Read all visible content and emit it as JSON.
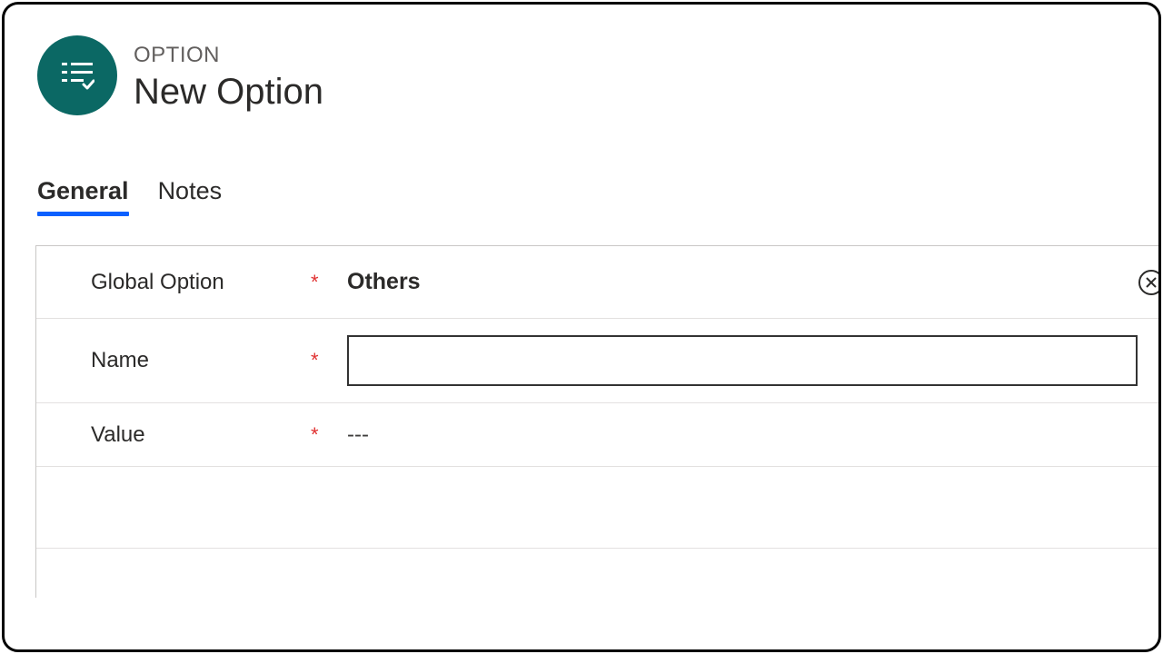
{
  "header": {
    "entity_label": "OPTION",
    "title": "New Option"
  },
  "tabs": [
    {
      "label": "General",
      "active": true
    },
    {
      "label": "Notes",
      "active": false
    }
  ],
  "form": {
    "global_option": {
      "label": "Global Option",
      "required_marker": "*",
      "value": "Others"
    },
    "name": {
      "label": "Name",
      "required_marker": "*",
      "value": ""
    },
    "value_field": {
      "label": "Value",
      "required_marker": "*",
      "value": "---"
    }
  }
}
